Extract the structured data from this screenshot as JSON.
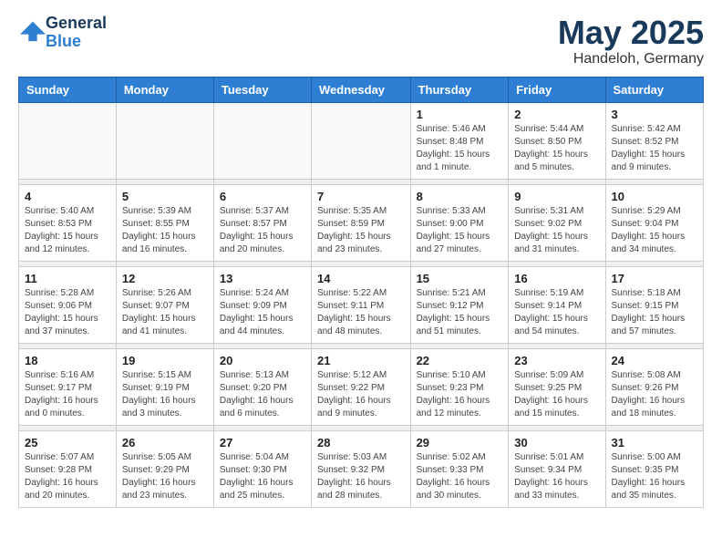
{
  "logo": {
    "text_general": "General",
    "text_blue": "Blue"
  },
  "header": {
    "title": "May 2025",
    "subtitle": "Handeloh, Germany"
  },
  "weekdays": [
    "Sunday",
    "Monday",
    "Tuesday",
    "Wednesday",
    "Thursday",
    "Friday",
    "Saturday"
  ],
  "weeks": [
    [
      {
        "day": "",
        "info": ""
      },
      {
        "day": "",
        "info": ""
      },
      {
        "day": "",
        "info": ""
      },
      {
        "day": "",
        "info": ""
      },
      {
        "day": "1",
        "info": "Sunrise: 5:46 AM\nSunset: 8:48 PM\nDaylight: 15 hours\nand 1 minute."
      },
      {
        "day": "2",
        "info": "Sunrise: 5:44 AM\nSunset: 8:50 PM\nDaylight: 15 hours\nand 5 minutes."
      },
      {
        "day": "3",
        "info": "Sunrise: 5:42 AM\nSunset: 8:52 PM\nDaylight: 15 hours\nand 9 minutes."
      }
    ],
    [
      {
        "day": "4",
        "info": "Sunrise: 5:40 AM\nSunset: 8:53 PM\nDaylight: 15 hours\nand 12 minutes."
      },
      {
        "day": "5",
        "info": "Sunrise: 5:39 AM\nSunset: 8:55 PM\nDaylight: 15 hours\nand 16 minutes."
      },
      {
        "day": "6",
        "info": "Sunrise: 5:37 AM\nSunset: 8:57 PM\nDaylight: 15 hours\nand 20 minutes."
      },
      {
        "day": "7",
        "info": "Sunrise: 5:35 AM\nSunset: 8:59 PM\nDaylight: 15 hours\nand 23 minutes."
      },
      {
        "day": "8",
        "info": "Sunrise: 5:33 AM\nSunset: 9:00 PM\nDaylight: 15 hours\nand 27 minutes."
      },
      {
        "day": "9",
        "info": "Sunrise: 5:31 AM\nSunset: 9:02 PM\nDaylight: 15 hours\nand 31 minutes."
      },
      {
        "day": "10",
        "info": "Sunrise: 5:29 AM\nSunset: 9:04 PM\nDaylight: 15 hours\nand 34 minutes."
      }
    ],
    [
      {
        "day": "11",
        "info": "Sunrise: 5:28 AM\nSunset: 9:06 PM\nDaylight: 15 hours\nand 37 minutes."
      },
      {
        "day": "12",
        "info": "Sunrise: 5:26 AM\nSunset: 9:07 PM\nDaylight: 15 hours\nand 41 minutes."
      },
      {
        "day": "13",
        "info": "Sunrise: 5:24 AM\nSunset: 9:09 PM\nDaylight: 15 hours\nand 44 minutes."
      },
      {
        "day": "14",
        "info": "Sunrise: 5:22 AM\nSunset: 9:11 PM\nDaylight: 15 hours\nand 48 minutes."
      },
      {
        "day": "15",
        "info": "Sunrise: 5:21 AM\nSunset: 9:12 PM\nDaylight: 15 hours\nand 51 minutes."
      },
      {
        "day": "16",
        "info": "Sunrise: 5:19 AM\nSunset: 9:14 PM\nDaylight: 15 hours\nand 54 minutes."
      },
      {
        "day": "17",
        "info": "Sunrise: 5:18 AM\nSunset: 9:15 PM\nDaylight: 15 hours\nand 57 minutes."
      }
    ],
    [
      {
        "day": "18",
        "info": "Sunrise: 5:16 AM\nSunset: 9:17 PM\nDaylight: 16 hours\nand 0 minutes."
      },
      {
        "day": "19",
        "info": "Sunrise: 5:15 AM\nSunset: 9:19 PM\nDaylight: 16 hours\nand 3 minutes."
      },
      {
        "day": "20",
        "info": "Sunrise: 5:13 AM\nSunset: 9:20 PM\nDaylight: 16 hours\nand 6 minutes."
      },
      {
        "day": "21",
        "info": "Sunrise: 5:12 AM\nSunset: 9:22 PM\nDaylight: 16 hours\nand 9 minutes."
      },
      {
        "day": "22",
        "info": "Sunrise: 5:10 AM\nSunset: 9:23 PM\nDaylight: 16 hours\nand 12 minutes."
      },
      {
        "day": "23",
        "info": "Sunrise: 5:09 AM\nSunset: 9:25 PM\nDaylight: 16 hours\nand 15 minutes."
      },
      {
        "day": "24",
        "info": "Sunrise: 5:08 AM\nSunset: 9:26 PM\nDaylight: 16 hours\nand 18 minutes."
      }
    ],
    [
      {
        "day": "25",
        "info": "Sunrise: 5:07 AM\nSunset: 9:28 PM\nDaylight: 16 hours\nand 20 minutes."
      },
      {
        "day": "26",
        "info": "Sunrise: 5:05 AM\nSunset: 9:29 PM\nDaylight: 16 hours\nand 23 minutes."
      },
      {
        "day": "27",
        "info": "Sunrise: 5:04 AM\nSunset: 9:30 PM\nDaylight: 16 hours\nand 25 minutes."
      },
      {
        "day": "28",
        "info": "Sunrise: 5:03 AM\nSunset: 9:32 PM\nDaylight: 16 hours\nand 28 minutes."
      },
      {
        "day": "29",
        "info": "Sunrise: 5:02 AM\nSunset: 9:33 PM\nDaylight: 16 hours\nand 30 minutes."
      },
      {
        "day": "30",
        "info": "Sunrise: 5:01 AM\nSunset: 9:34 PM\nDaylight: 16 hours\nand 33 minutes."
      },
      {
        "day": "31",
        "info": "Sunrise: 5:00 AM\nSunset: 9:35 PM\nDaylight: 16 hours\nand 35 minutes."
      }
    ]
  ]
}
